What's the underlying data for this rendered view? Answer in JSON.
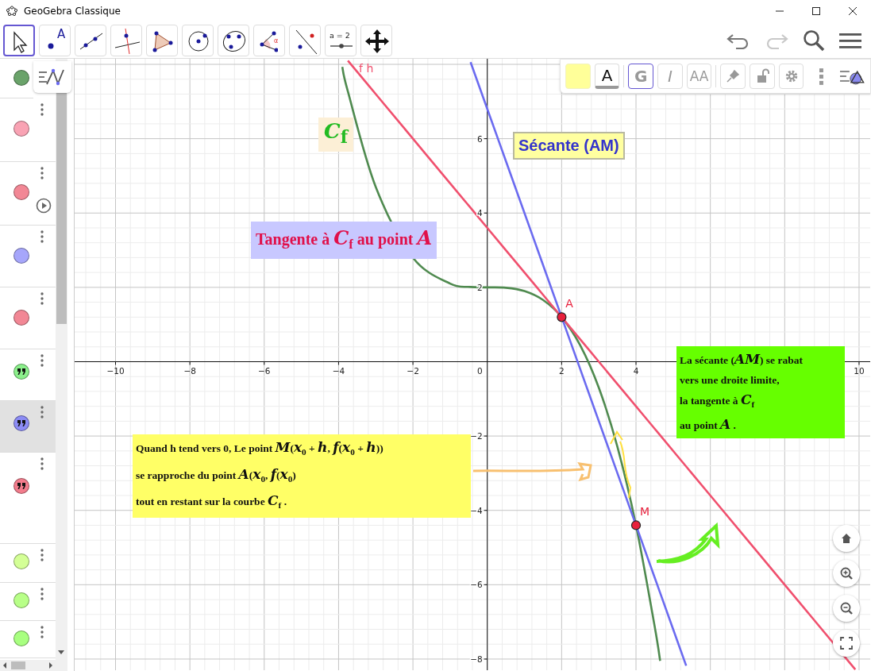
{
  "window": {
    "title": "GeoGebra Classique"
  },
  "tools": [
    {
      "selected": true,
      "kind": "move"
    },
    {
      "selected": false,
      "kind": "point",
      "label": "A"
    },
    {
      "selected": false,
      "kind": "line"
    },
    {
      "selected": false,
      "kind": "perpendicular"
    },
    {
      "selected": false,
      "kind": "polygon"
    },
    {
      "selected": false,
      "kind": "circle"
    },
    {
      "selected": false,
      "kind": "conic"
    },
    {
      "selected": false,
      "kind": "angle",
      "label": "α"
    },
    {
      "selected": false,
      "kind": "reflect"
    },
    {
      "selected": false,
      "kind": "slider",
      "label": "a = 2"
    },
    {
      "selected": false,
      "kind": "pan"
    }
  ],
  "history": {
    "undo_disabled": false,
    "redo_disabled": true
  },
  "algebra": {
    "rows": [
      {
        "kind": "object",
        "color": "#6aa36a",
        "selected": false
      },
      {
        "kind": "object",
        "color": "#f9a3b4",
        "selected": false
      },
      {
        "kind": "slider",
        "color": "#f28795",
        "selected": false
      },
      {
        "kind": "object",
        "color": "#a6a6fb",
        "selected": false
      },
      {
        "kind": "object",
        "color": "#f28795",
        "selected": false
      },
      {
        "kind": "text",
        "color": "#8cf08c",
        "selected": false
      },
      {
        "kind": "text",
        "color": "#8c8cf5",
        "selected": true
      },
      {
        "kind": "text",
        "color": "#f27c8c",
        "selected": false
      },
      {
        "kind": "object",
        "color": "#d4ff96",
        "selected": false
      },
      {
        "kind": "object",
        "color": "#b8ff88",
        "selected": false
      },
      {
        "kind": "object",
        "color": "#a8ff80",
        "selected": false
      }
    ]
  },
  "style_bar": [
    {
      "kind": "swatch",
      "color": "#ffff99"
    },
    {
      "kind": "text-color",
      "label": "A"
    },
    {
      "kind": "bold",
      "label": "G",
      "on": true
    },
    {
      "kind": "italic",
      "label": "I",
      "on": false
    },
    {
      "kind": "size",
      "label": "AA"
    },
    {
      "kind": "pin"
    },
    {
      "kind": "lock"
    },
    {
      "kind": "settings"
    },
    {
      "kind": "more"
    },
    {
      "kind": "toggle"
    }
  ],
  "graphics": {
    "chart_data": {
      "type": "line",
      "grid": true,
      "x": [
        -3.9,
        -3.75,
        -3,
        -2,
        -1,
        -0.45,
        0,
        0.5,
        1,
        1.5,
        2,
        2.5,
        3,
        3.5,
        4,
        4.5,
        4.65,
        5.35,
        6,
        8,
        9.9
      ],
      "xlim": [
        -11.1,
        10.3
      ],
      "ylim": [
        -8.3,
        8.15
      ],
      "xticks": [
        -10,
        -8,
        -6,
        -4,
        -2,
        2,
        4,
        10
      ],
      "yticks": [
        -8,
        -6,
        -4,
        -2,
        2,
        4,
        6
      ],
      "series": [
        {
          "name": "*C*$_{f}$",
          "color": "#4f8a4f",
          "values": [
            7.93,
            7.27,
            4.7,
            2.8,
            2.1,
            2.01,
            2,
            1.99,
            1.9,
            1.66,
            1.2,
            0.44,
            -0.7,
            -2.29,
            -4.4,
            -7.11,
            -8.05,
            null,
            null,
            null,
            null
          ]
        },
        {
          "name": "f h",
          "color": "#f0506e",
          "values": [
            null,
            8.1,
            7.2,
            6,
            4.8,
            4.14,
            3.6,
            3,
            2.4,
            1.8,
            1.2,
            0.6,
            0,
            -0.6,
            -1.2,
            -1.8,
            -1.98,
            -2.82,
            -3.6,
            -6,
            -8.28
          ]
        },
        {
          "name": "Sécante (AM)",
          "color": "#6b6bf0",
          "values": [
            null,
            null,
            null,
            null,
            null,
            8.06,
            6.8,
            5.4,
            4,
            2.6,
            null,
            -0.2,
            -1.6,
            -3,
            null,
            -5.8,
            -6.22,
            -8.18,
            null,
            null,
            null
          ]
        }
      ],
      "annotations": [
        {
          "text": "A",
          "x": 2,
          "y": 1.2
        },
        {
          "text": "M",
          "x": 4,
          "y": -4.4
        }
      ]
    },
    "origin_label": "0",
    "texts": [
      {
        "kind": "tangent-title",
        "lines": [
          "Tangente à *C*$_{f}$ au point *A*"
        ]
      },
      {
        "kind": "note",
        "lines": [
          "Quand h tend vers 0, Le point *M*(*x*$_{0}$ + *h*, *f*(*x*$_{0}$ + *h*))",
          "se rapproche du point *A*(*x*$_{0}$, *f*(*x*$_{0}$)",
          "tout en restant sur la courbe *C*$_{f}$ ."
        ]
      },
      {
        "kind": "conclusion",
        "lines": [
          "La sécante (*AM*) se rabat",
          "vers une droite limite,",
          "la tangente à *C*$_{f}$",
          "au point *A* ."
        ]
      }
    ]
  }
}
